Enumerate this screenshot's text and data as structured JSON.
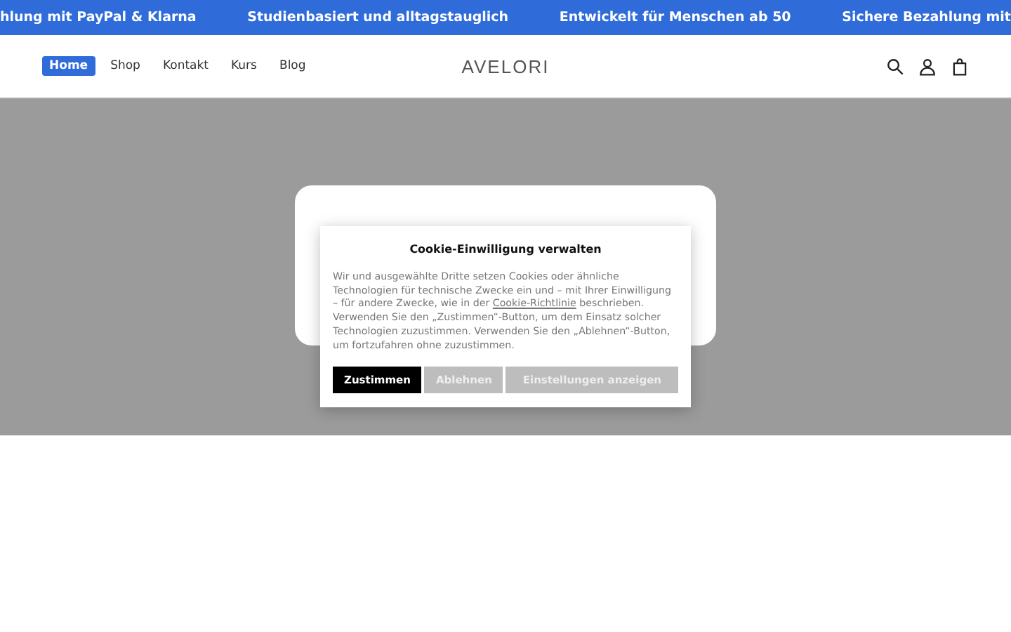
{
  "announcement_bar": [
    "hlung mit PayPal & Klarna",
    "Studienbasiert und alltagstauglich",
    "Entwickelt für Menschen ab 50",
    "Sichere Bezahlung mit"
  ],
  "nav": [
    {
      "label": "Home",
      "selected": true
    },
    {
      "label": "Shop",
      "selected": false
    },
    {
      "label": "Kontakt",
      "selected": false
    },
    {
      "label": "Kurs",
      "selected": false
    },
    {
      "label": "Blog",
      "selected": false
    }
  ],
  "logo": "AVELORI",
  "cookie_dialog": {
    "title": "Cookie-Einwilligung verwalten",
    "text_before": "Wir und ausgewählte Dritte setzen Cookies oder ähnliche Technologien für technische Zwecke ein und – mit Ihrer Einwilligung – für andere Zwecke, wie in der ",
    "link": "Cookie-Richtlinie",
    "text_after": " beschrieben. Verwenden Sie den „Zustimmen“-Button, um dem Einsatz solcher Technologien zuzustimmen. Verwenden Sie den „Ablehnen“-Button, um fortzufahren ohne zuzustimmen.",
    "buttons": [
      {
        "label": "Zustimmen",
        "kind": "primary"
      },
      {
        "label": "Ablehnen",
        "kind": "secondary"
      },
      {
        "label": "Einstellungen anzeigen",
        "kind": "secondary"
      }
    ]
  }
}
